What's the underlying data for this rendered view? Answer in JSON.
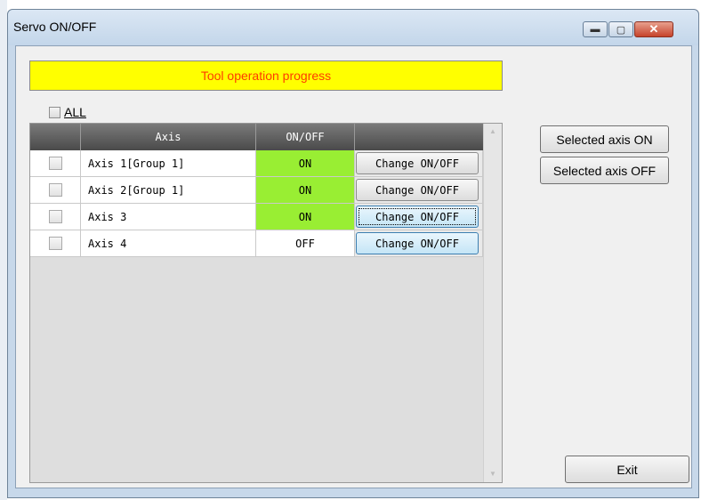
{
  "window": {
    "title": "Servo ON/OFF",
    "minimize_icon": "minimize-icon",
    "maximize_icon": "maximize-icon",
    "close_icon": "close-icon",
    "min_glyph": "▬",
    "max_glyph": "▢",
    "close_glyph": "✕"
  },
  "progress": {
    "text": "Tool operation progress",
    "bg_color": "#ffff00",
    "text_color": "#ff3b00"
  },
  "all_label": "ALL",
  "grid": {
    "headers": {
      "check": "",
      "axis": "Axis",
      "state": "ON/OFF",
      "action": ""
    },
    "rows": [
      {
        "axis": "Axis 1[Group 1]",
        "state": "ON",
        "action": "Change ON/OFF"
      },
      {
        "axis": "Axis 2[Group 1]",
        "state": "ON",
        "action": "Change ON/OFF"
      },
      {
        "axis": "Axis 3",
        "state": "ON",
        "action": "Change ON/OFF"
      },
      {
        "axis": "Axis 4",
        "state": "OFF",
        "action": "Change ON/OFF"
      }
    ],
    "on_color": "#99ee33",
    "scroll_up_glyph": "▲",
    "scroll_down_glyph": "▼"
  },
  "buttons": {
    "selected_on": "Selected axis ON",
    "selected_off": "Selected axis OFF",
    "exit": "Exit"
  }
}
